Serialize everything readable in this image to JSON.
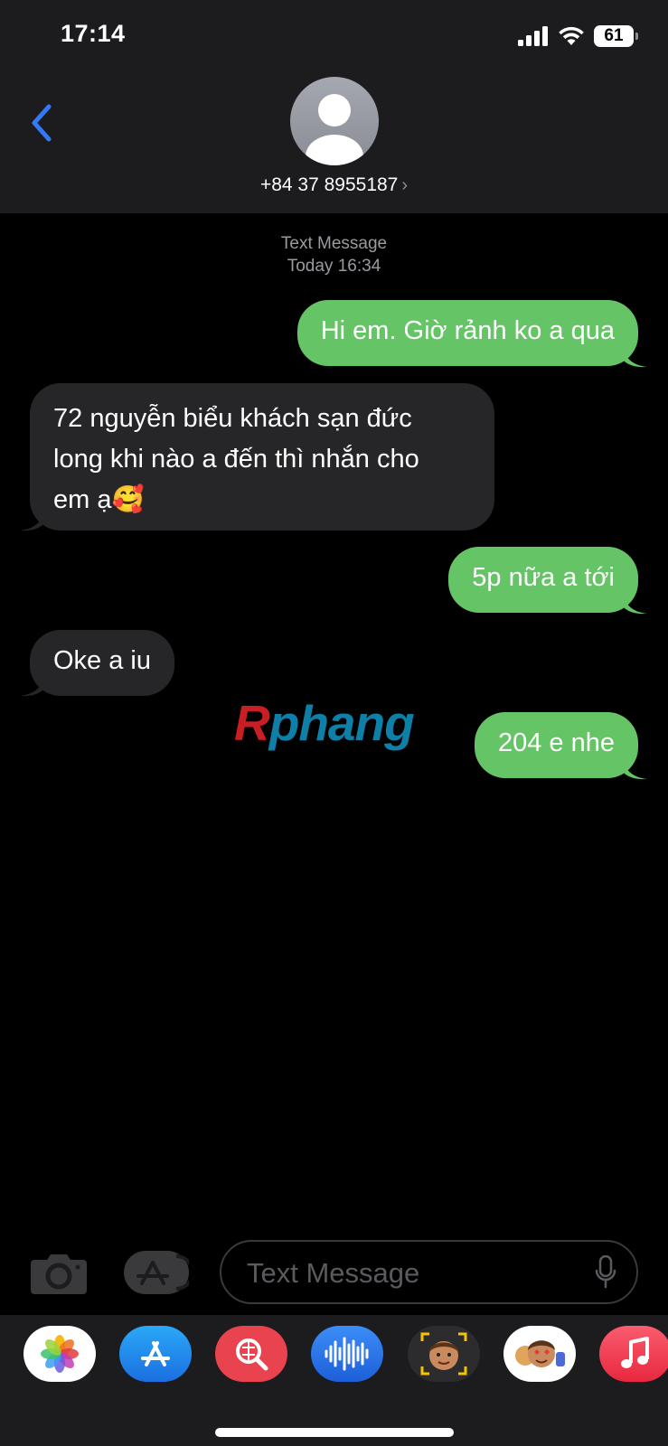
{
  "status_bar": {
    "time": "17:14",
    "battery": "61"
  },
  "header": {
    "contact": "+84 37 8955187",
    "chevron": "›"
  },
  "thread": {
    "service": "Text Message",
    "timestamp": "Today 16:34",
    "messages": [
      {
        "direction": "out",
        "lines": [
          "Hi em. Giờ rảnh ko a qua"
        ]
      },
      {
        "direction": "in",
        "lines": [
          "72 nguyễn biểu khách sạn đức",
          "long khi nào a đến thì nhắn cho",
          "em ạ🥰"
        ]
      },
      {
        "direction": "out",
        "lines": [
          "5p nữa a tới"
        ]
      },
      {
        "direction": "in",
        "lines": [
          "Oke a iu"
        ]
      },
      {
        "direction": "out",
        "lines": [
          "204 e nhe"
        ]
      }
    ]
  },
  "watermark": {
    "first": "R",
    "rest": "phang"
  },
  "composer": {
    "placeholder": "Text Message"
  },
  "app_strip": {
    "icons": [
      "photos-icon",
      "app-store-icon",
      "images-search-icon",
      "audio-message-icon",
      "memoji-icon",
      "memoji-stickers-icon",
      "music-icon"
    ]
  },
  "colors": {
    "outgoing": "#65c466",
    "incoming": "#262628",
    "accent": "#3478f6",
    "background": "#000000"
  }
}
